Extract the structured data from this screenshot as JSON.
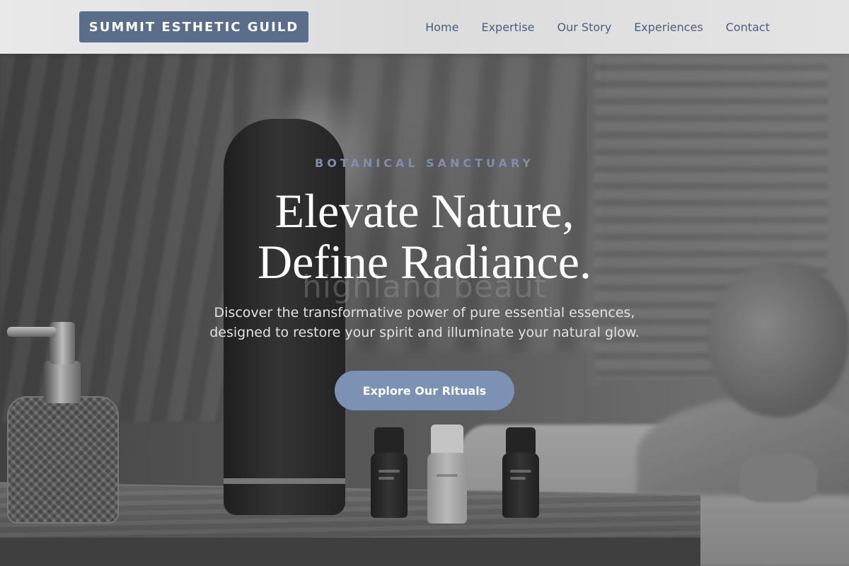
{
  "header": {
    "logo": "SUMMIT ESTHETIC GUILD",
    "nav": [
      {
        "label": "Home"
      },
      {
        "label": "Expertise"
      },
      {
        "label": "Our Story"
      },
      {
        "label": "Experiences"
      },
      {
        "label": "Contact"
      }
    ]
  },
  "hero": {
    "eyebrow": "BOTANICAL SANCTUARY",
    "headline_line1": "Elevate Nature,",
    "headline_line2": "Define Radiance.",
    "background_text": "highland beaut",
    "subtitle_line1": "Discover the transformative power of pure essential essences,",
    "subtitle_line2": "designed to restore your spirit and illuminate your natural glow.",
    "cta_label": "Explore Our Rituals"
  },
  "colors": {
    "accent": "#7b92b4",
    "logo_bg": "#5a6e8c",
    "nav_text": "#4a5f7e",
    "eyebrow_text": "#7d8fab"
  }
}
